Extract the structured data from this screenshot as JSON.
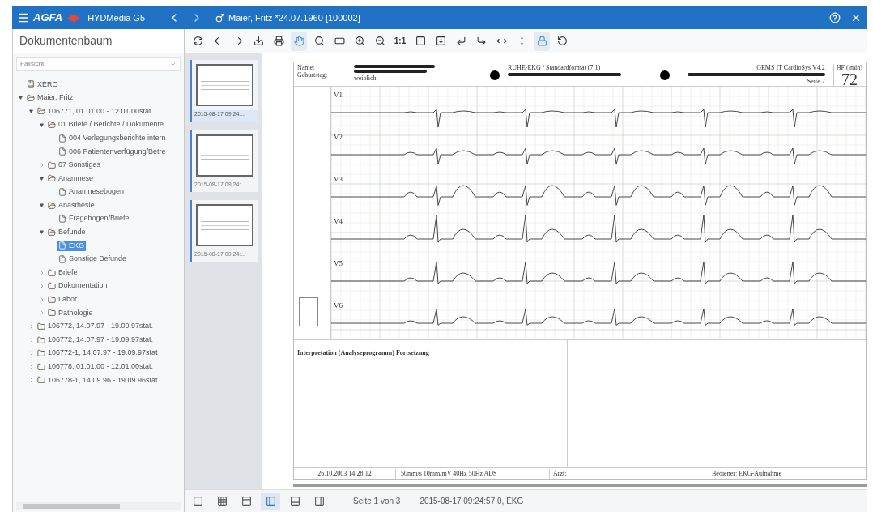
{
  "app": {
    "logo": "AGFA",
    "title": "HYDMedia G5",
    "patient": "Maier, Fritz *24.07.1960 [100002]"
  },
  "tree_panel": {
    "title": "Dokumentenbaum",
    "view_select": "Fallsicht",
    "items": [
      {
        "label": "XERO",
        "kind": "record",
        "selected": false
      },
      {
        "label": "Maier, Fritz",
        "kind": "folder",
        "expanded": true,
        "selected": false,
        "children": [
          {
            "label": "106771, 01.01.00 - 12.01.00stat.",
            "kind": "folder",
            "expanded": true,
            "selected": false,
            "children": [
              {
                "label": "01 Briefe / Berichte / Dokumente",
                "kind": "folder",
                "expanded": true,
                "selected": false,
                "children": [
                  {
                    "label": "004 Verlegungsberichte intern",
                    "kind": "doc",
                    "selected": false
                  },
                  {
                    "label": "006 Patientenverfügung/Betre",
                    "kind": "doc",
                    "selected": false
                  }
                ]
              },
              {
                "label": "07 Sonstiges",
                "kind": "folder",
                "expanded": false,
                "selected": false
              },
              {
                "label": "Anamnese",
                "kind": "folder",
                "expanded": true,
                "selected": false,
                "children": [
                  {
                    "label": "Anamnesebogen",
                    "kind": "doc",
                    "selected": false
                  }
                ]
              },
              {
                "label": "Anästhesie",
                "kind": "folder",
                "expanded": true,
                "selected": false,
                "children": [
                  {
                    "label": "Fragebogen/Briefe",
                    "kind": "doc",
                    "selected": false
                  }
                ]
              },
              {
                "label": "Befunde",
                "kind": "folder",
                "expanded": true,
                "selected": false,
                "children": [
                  {
                    "label": "EKG",
                    "kind": "doc",
                    "selected": true
                  },
                  {
                    "label": "Sonstige Befunde",
                    "kind": "doc",
                    "selected": false
                  }
                ]
              },
              {
                "label": "Briefe",
                "kind": "folder",
                "expanded": false,
                "selected": false
              },
              {
                "label": "Dokumentation",
                "kind": "folder",
                "expanded": false,
                "selected": false
              },
              {
                "label": "Labor",
                "kind": "folder",
                "expanded": false,
                "selected": false
              },
              {
                "label": "Pathologie",
                "kind": "folder",
                "expanded": false,
                "selected": false
              }
            ]
          },
          {
            "label": "106772, 14.07.97 - 19.09.97stat.",
            "kind": "folder",
            "expanded": false,
            "selected": false
          },
          {
            "label": "106772, 14.07.97 - 19.09.97stat.",
            "kind": "folder",
            "expanded": false,
            "selected": false
          },
          {
            "label": "106772-1, 14.07.97 - 19.09.97stat",
            "kind": "folder",
            "expanded": false,
            "selected": false
          },
          {
            "label": "106778, 01.01.00 - 12.01.00stat.",
            "kind": "folder",
            "expanded": false,
            "selected": false
          },
          {
            "label": "106778-1, 14.09.96 - 19.09.96stat",
            "kind": "folder",
            "expanded": false,
            "selected": false
          }
        ]
      }
    ]
  },
  "toolbar": [
    {
      "kind": "refresh",
      "selected": false
    },
    {
      "kind": "back",
      "selected": false
    },
    {
      "kind": "forward",
      "selected": false
    },
    {
      "kind": "download",
      "selected": false
    },
    {
      "kind": "print",
      "selected": false
    },
    {
      "kind": "hand",
      "selected": true
    },
    {
      "kind": "zoom-select",
      "selected": false
    },
    {
      "kind": "rectangle",
      "selected": false
    },
    {
      "kind": "zoom-in",
      "selected": false
    },
    {
      "kind": "zoom-out",
      "selected": false
    },
    {
      "kind": "actual-size",
      "label": "1:1",
      "selected": false
    },
    {
      "kind": "fit-height",
      "selected": false
    },
    {
      "kind": "fit-page",
      "selected": false
    },
    {
      "kind": "rotate-left",
      "selected": false
    },
    {
      "kind": "rotate-right",
      "selected": false
    },
    {
      "kind": "split-vertical",
      "selected": false
    },
    {
      "kind": "split-horizontal",
      "selected": false
    },
    {
      "kind": "lock",
      "selected": true
    },
    {
      "kind": "reset",
      "selected": false
    }
  ],
  "thumbnails": [
    {
      "caption": "2015-08-17 09:24:...",
      "selected": true
    },
    {
      "caption": "2015-08-17 09:24:...",
      "selected": false
    },
    {
      "caption": "2015-08-17 09:24:...",
      "selected": false
    }
  ],
  "document": {
    "name_label": "Name:",
    "birth_label": "Geburtstag:",
    "sex": "weiblich",
    "format": "RUHE-EKG / Standardformat (7.1)",
    "software": "GEMS IT CardioSys V4.2",
    "hr_label": "HF (/min)",
    "hr_value": "72",
    "page": "Seite 2",
    "leads": [
      "V1",
      "V2",
      "V3",
      "V4",
      "V5",
      "V6"
    ],
    "interpretation": "Interpretation (Analyseprogramm) Fortsetzung",
    "timestamp": "26.10.2003 14:28:12",
    "settings": "50mm/s 10mm/mV 40Hz 50Hz ADS",
    "doctor": "Arzt:",
    "operator": "Bediener: EKG-Aufnahme"
  },
  "view_buttons": [
    {
      "kind": "single",
      "selected": false
    },
    {
      "kind": "grid",
      "selected": false
    },
    {
      "kind": "top",
      "selected": false
    },
    {
      "kind": "left",
      "selected": true
    },
    {
      "kind": "bottom",
      "selected": false
    },
    {
      "kind": "right",
      "selected": false
    }
  ],
  "status": {
    "page": "Seite 1 von 3",
    "info": "2015-08-17 09:24:57.0, EKG"
  }
}
